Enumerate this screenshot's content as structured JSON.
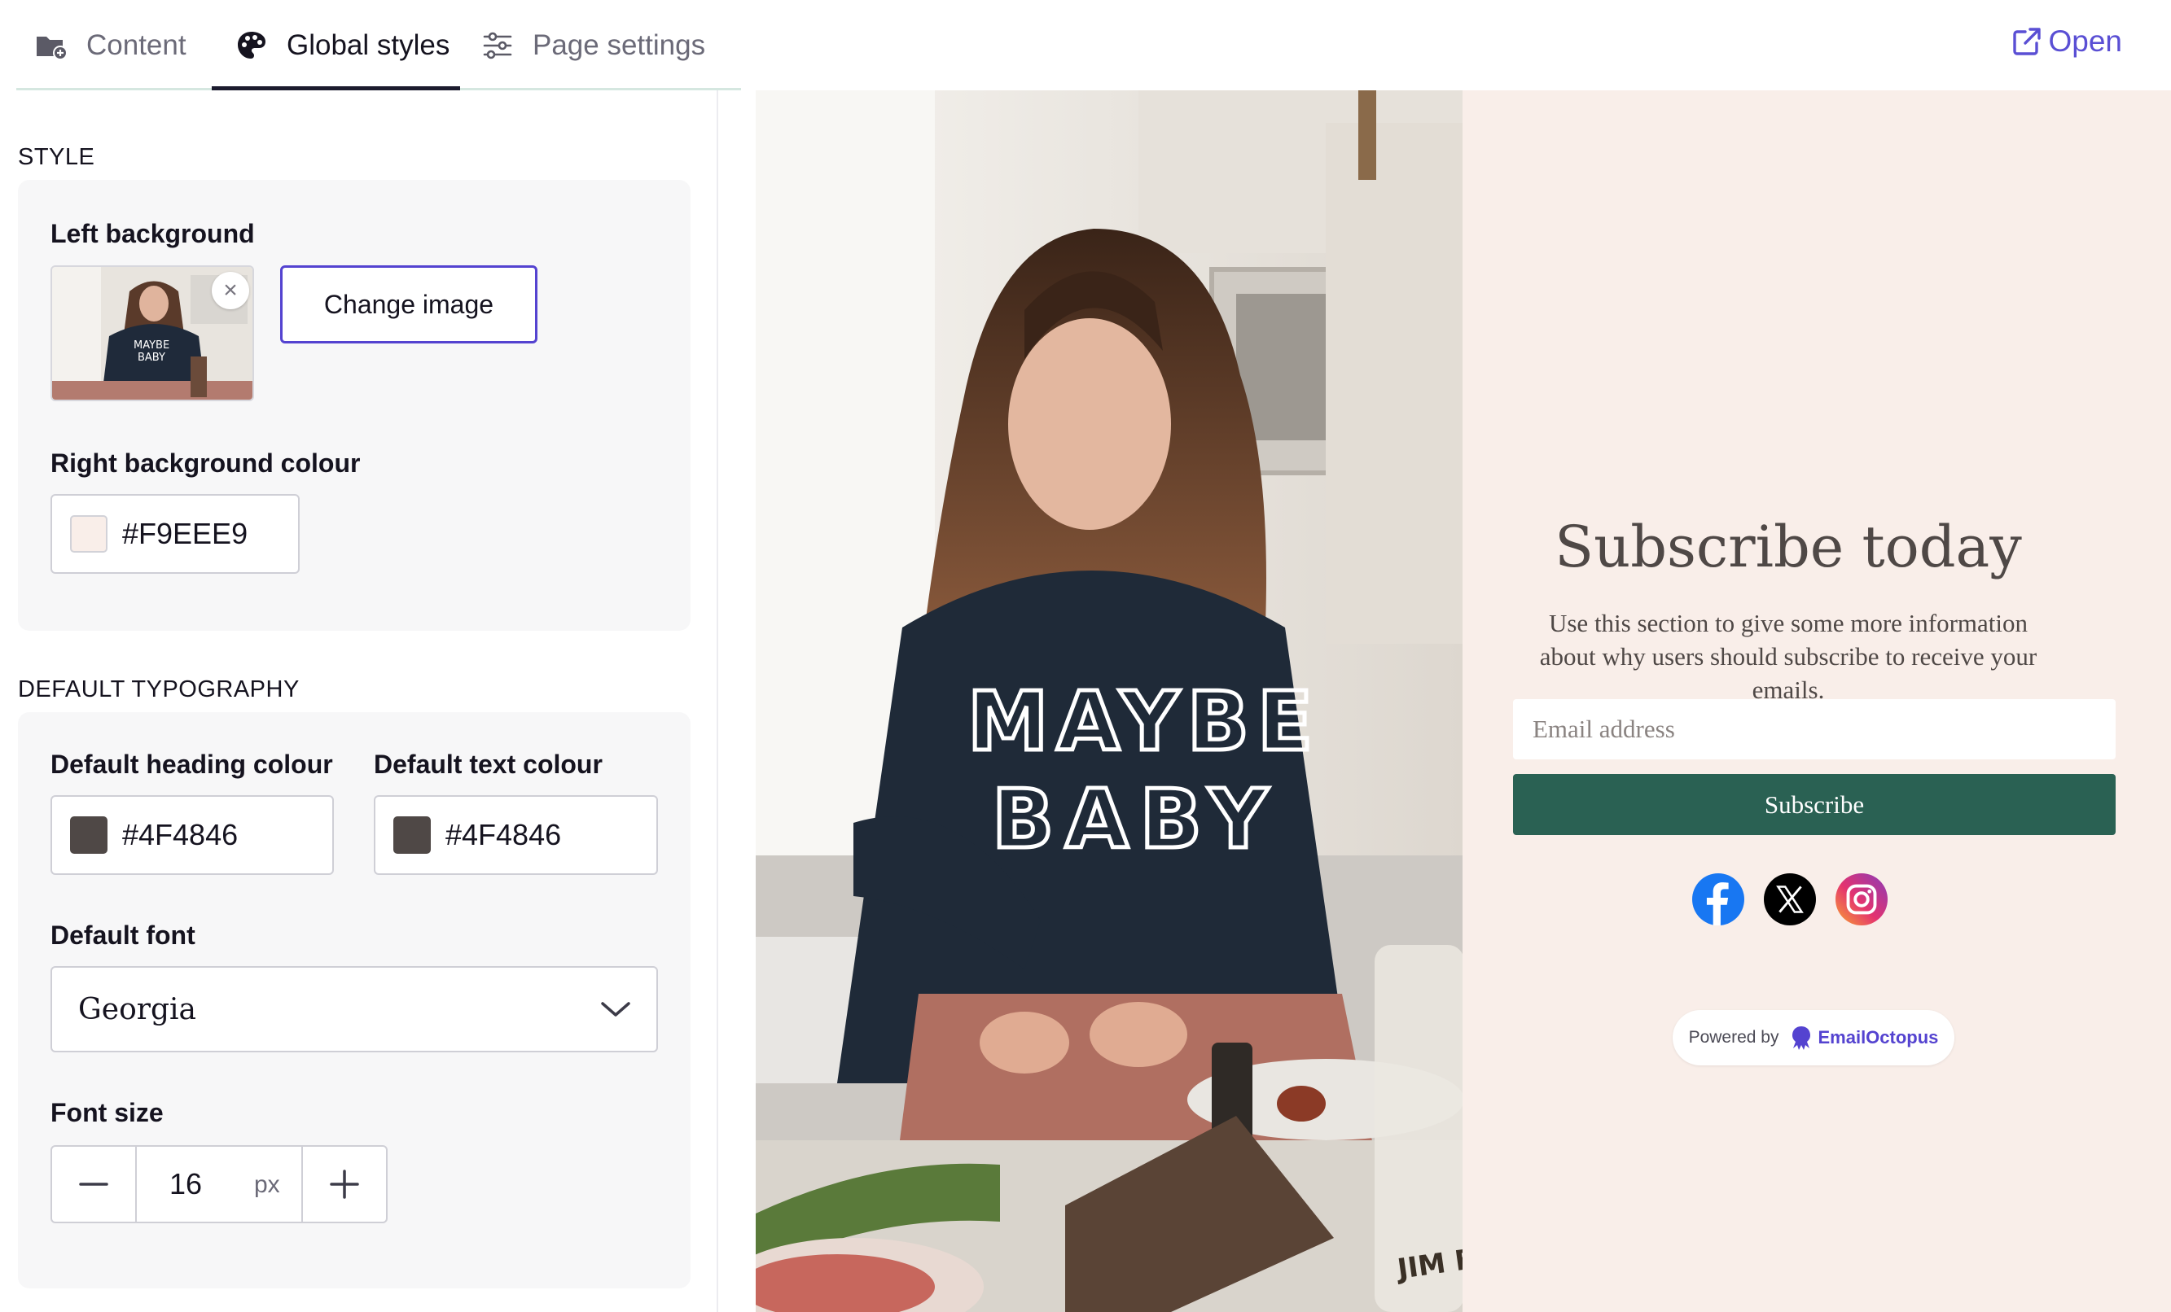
{
  "tabs": [
    {
      "label": "Content",
      "icon": "folder-plus-icon"
    },
    {
      "label": "Global styles",
      "icon": "palette-icon",
      "active": true
    },
    {
      "label": "Page settings",
      "icon": "sliders-icon"
    }
  ],
  "open_link": {
    "label": "Open",
    "icon": "external-link-icon"
  },
  "style_section": {
    "title": "STYLE",
    "left_background_label": "Left background",
    "change_image_label": "Change image",
    "right_background_label": "Right background colour",
    "right_background_value": "#F9EEE9"
  },
  "typography_section": {
    "title": "DEFAULT TYPOGRAPHY",
    "heading_colour_label": "Default heading colour",
    "heading_colour_value": "#4F4846",
    "text_colour_label": "Default text colour",
    "text_colour_value": "#4F4846",
    "font_label": "Default font",
    "font_value": "Georgia",
    "font_size_label": "Font size",
    "font_size_value": "16",
    "font_size_unit": "px"
  },
  "preview": {
    "heading": "Subscribe today",
    "subtext": "Use this section to give some more information about why users should subscribe to receive your emails.",
    "email_placeholder": "Email address",
    "subscribe_label": "Subscribe",
    "socials": [
      "facebook-icon",
      "x-icon",
      "instagram-icon"
    ],
    "powered_by": "Powered by",
    "brand": "EmailOctopus",
    "photo_shirt_line1": "MAYBE",
    "photo_shirt_line2": "BABY",
    "photo_bottle_label": "JIM BEAM"
  },
  "colors": {
    "accent": "#5443D0",
    "button": "#2A6153",
    "right_bg": "#F9EEE9",
    "heading": "#4F4846",
    "text": "#4F4846"
  }
}
